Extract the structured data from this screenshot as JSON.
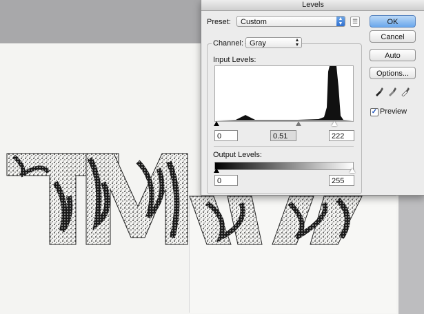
{
  "dialog": {
    "title": "Levels",
    "preset_label": "Preset:",
    "preset_value": "Custom",
    "channel_label": "Channel:",
    "channel_value": "Gray",
    "input_levels_label": "Input Levels:",
    "input_black": "0",
    "input_gamma": "0.51",
    "input_white": "222",
    "output_levels_label": "Output Levels:",
    "output_black": "0",
    "output_white": "255",
    "ok_label": "OK",
    "cancel_label": "Cancel",
    "auto_label": "Auto",
    "options_label": "Options...",
    "preview_label": "Preview",
    "preview_checked": true
  },
  "canvas": {
    "artwork_letters": "TMW",
    "paper_color": "#f4f4f2"
  },
  "colors": {
    "accent_blue": "#2e6fd0",
    "ok_button": "#6aa7ec"
  }
}
